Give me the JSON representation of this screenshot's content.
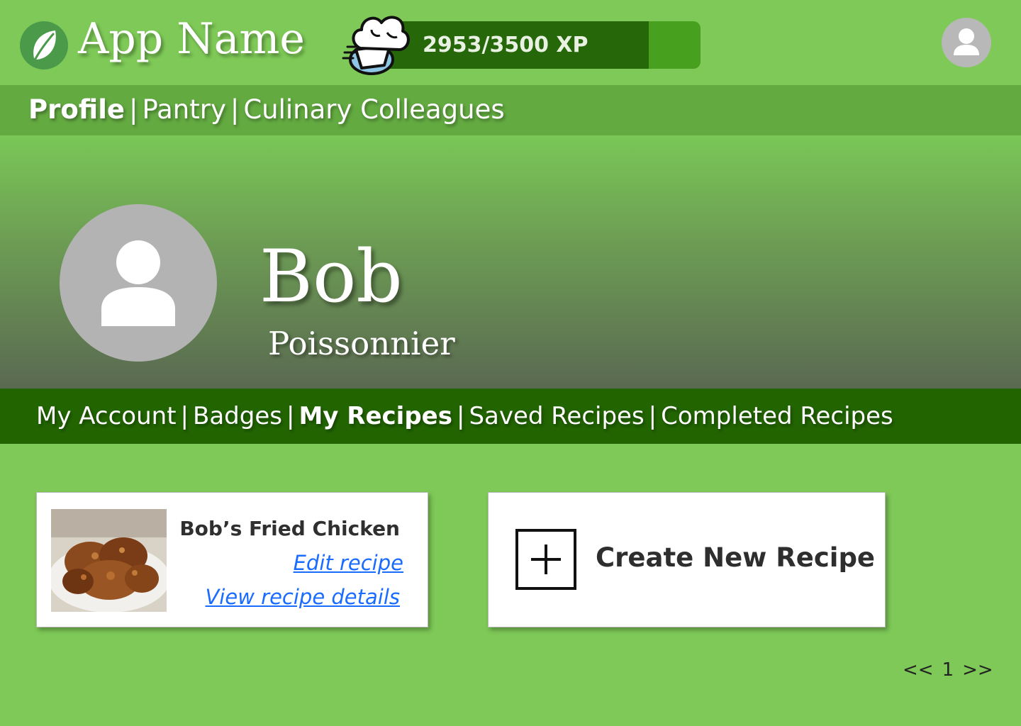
{
  "header": {
    "app_name": "App Name",
    "xp": {
      "label": "2953/3500 XP",
      "current": 2953,
      "max": 3500
    }
  },
  "main_nav": {
    "items": [
      {
        "label": "Profile",
        "active": true
      },
      {
        "label": "Pantry",
        "active": false
      },
      {
        "label": "Culinary Colleagues",
        "active": false
      }
    ],
    "separator": "|"
  },
  "profile": {
    "name": "Bob",
    "title": "Poissonnier"
  },
  "profile_nav": {
    "items": [
      {
        "label": "My Account",
        "active": false
      },
      {
        "label": "Badges",
        "active": false
      },
      {
        "label": "My Recipes",
        "active": true
      },
      {
        "label": "Saved Recipes",
        "active": false
      },
      {
        "label": "Completed Recipes",
        "active": false
      }
    ],
    "separator": "|"
  },
  "recipes": [
    {
      "title": "Bob’s Fried Chicken",
      "edit_label": "Edit recipe",
      "view_label": "View recipe details"
    }
  ],
  "create_card": {
    "label": "Create New Recipe"
  },
  "pagination": {
    "prev_label": "<<",
    "current_page": "1",
    "next_label": ">>"
  },
  "icons": {
    "logo": "leaf-icon",
    "xp": "chef-hat-icon",
    "user": "user-icon",
    "create": "plus-icon"
  },
  "colors": {
    "page_background": "#7ec957",
    "main_nav_background": "#63aa41",
    "profile_nav_background": "#226500",
    "xp_fill": "#256709",
    "xp_track": "#47a11e",
    "link": "#1a6cff"
  }
}
